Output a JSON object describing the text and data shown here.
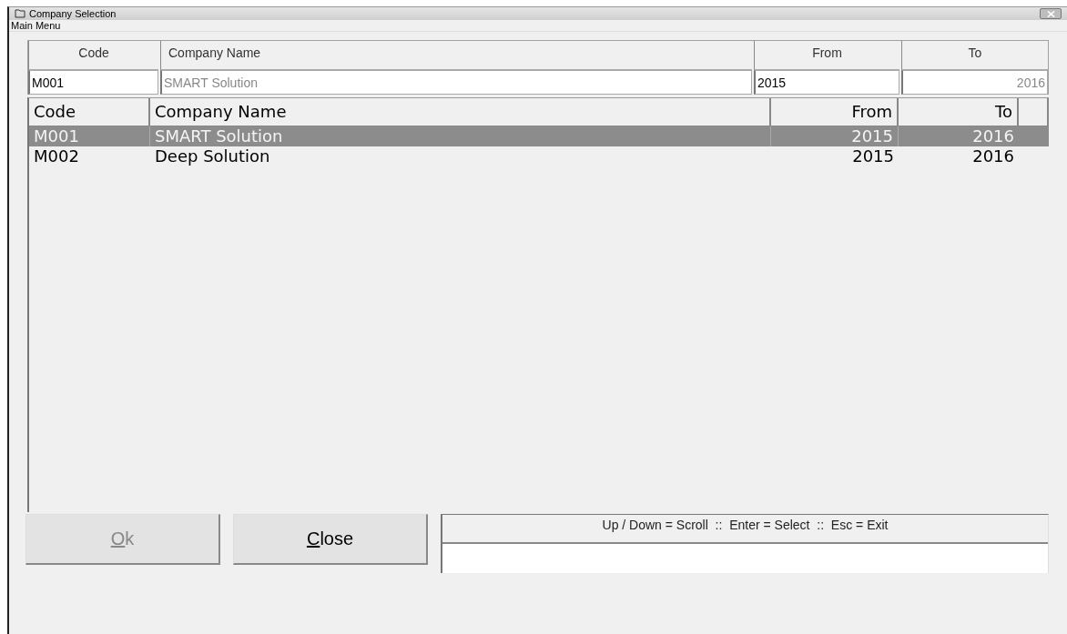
{
  "window": {
    "title": "Company Selection"
  },
  "menu": [
    "Main Menu"
  ],
  "filter": {
    "columns": [
      "Code",
      "Company Name",
      "From",
      "To"
    ],
    "fields": [
      {
        "value": "M001",
        "disabled": false
      },
      {
        "value": "SMART Solution",
        "disabled": true
      },
      {
        "value": "2015",
        "disabled": false
      },
      {
        "value": "2016",
        "disabled": true
      }
    ]
  },
  "table": {
    "columns": [
      "Code",
      "Company Name",
      "From",
      "To"
    ],
    "rows": [
      {
        "selected": true,
        "cells": [
          "M001",
          "SMART Solution",
          "2015",
          "2016"
        ]
      },
      {
        "selected": false,
        "cells": [
          "M002",
          "Deep Solution",
          "2015",
          "2016"
        ]
      }
    ]
  },
  "buttons": [
    {
      "label": "Ok",
      "disabled": true
    },
    {
      "label": "Close",
      "disabled": false
    }
  ],
  "hint": "Up / Down = Scroll  ::  Enter = Select  ::  Esc = Exit"
}
